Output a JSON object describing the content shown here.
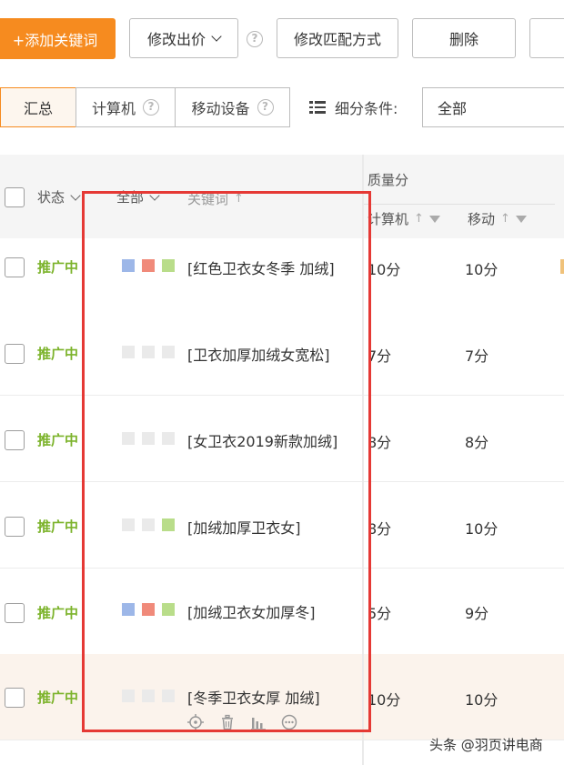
{
  "toolbar": {
    "add_keyword": "+添加关键词",
    "modify_bid": "修改出价",
    "modify_match": "修改匹配方式",
    "delete": "删除"
  },
  "tabs": [
    {
      "label": "汇总",
      "active": true
    },
    {
      "label": "计算机",
      "help": true
    },
    {
      "label": "移动设备",
      "help": true
    }
  ],
  "filter": {
    "label": "细分条件:",
    "value": "全部"
  },
  "table": {
    "headers": {
      "status": "状态",
      "all": "全部",
      "keyword": "关键词",
      "quality": "质量分",
      "computer": "计算机",
      "mobile": "移动"
    },
    "rows": [
      {
        "status": "推广中",
        "keyword": "[红色卫衣女冬季 加绒]",
        "q_pc": "10分",
        "q_mobile": "10分",
        "dots": [
          "#9db7e8",
          "#f08a7a",
          "#b9dd8a"
        ]
      },
      {
        "status": "推广中",
        "keyword": "[卫衣加厚加绒女宽松]",
        "q_pc": "7分",
        "q_mobile": "7分",
        "dots": [
          "#eaeaea",
          "#eaeaea",
          "#eaeaea"
        ]
      },
      {
        "status": "推广中",
        "keyword": "[女卫衣2019新款加绒]",
        "q_pc": "8分",
        "q_mobile": "8分",
        "dots": [
          "#eaeaea",
          "#eaeaea",
          "#eaeaea"
        ]
      },
      {
        "status": "推广中",
        "keyword": "[加绒加厚卫衣女]",
        "q_pc": "8分",
        "q_mobile": "10分",
        "dots": [
          "#eaeaea",
          "#eaeaea",
          "#b9dd8a"
        ]
      },
      {
        "status": "推广中",
        "keyword": "[加绒卫衣女加厚冬]",
        "q_pc": "5分",
        "q_mobile": "9分",
        "dots": [
          "#9db7e8",
          "#f08a7a",
          "#b9dd8a"
        ]
      },
      {
        "status": "推广中",
        "keyword": "[冬季卫衣女厚 加绒]",
        "q_pc": "10分",
        "q_mobile": "10分",
        "dots": [
          "#eaeaea",
          "#eaeaea",
          "#eaeaea"
        ]
      }
    ]
  },
  "watermark": "头条 @羽页讲电商"
}
